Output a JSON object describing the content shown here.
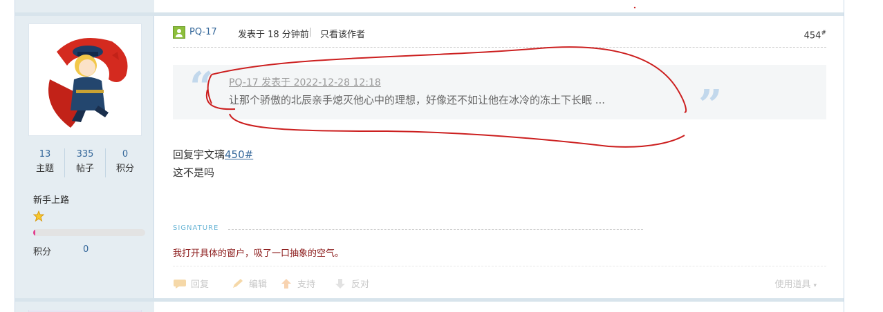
{
  "sidebar": {
    "stats": [
      {
        "value": "13",
        "label": "主题"
      },
      {
        "value": "335",
        "label": "帖子"
      },
      {
        "value": "0",
        "label": "积分"
      }
    ],
    "rank": "新手上路",
    "progress_fraction": 0.02,
    "credits_label": "积分",
    "credits_value": "0"
  },
  "post": {
    "author": "PQ-17",
    "posted": "发表于 18 分钟前",
    "only_author": "只看该作者",
    "floor": "454",
    "floor_mark": "#",
    "quote_header": "PQ-17 发表于 2022-12-28 12:18",
    "quote_text": "让那个骄傲的北辰亲手熄灭他心中的理想，好像还不如让他在冰冷的冻土下长眠 ...",
    "reply_prefix": "回复宇文璃",
    "reply_link": "450#",
    "body": "这不是吗",
    "signature_label": "SIGNATURE",
    "signature": "我打开具体的窗户，吸了一口抽象的空气。"
  },
  "actions": {
    "reply": "回复",
    "edit": "编辑",
    "support": "支持",
    "oppose": "反对",
    "props": "使用道具"
  },
  "colors": {
    "accent": "#336699",
    "annotation": "#cc1f1f"
  }
}
